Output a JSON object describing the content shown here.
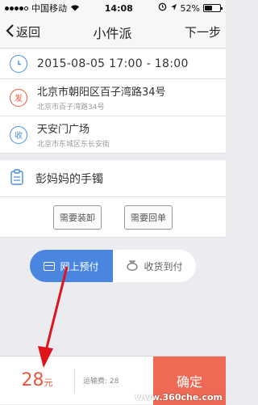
{
  "status_bar": {
    "carrier": "中国移动",
    "time": "14:08",
    "battery": "52%",
    "battery_level": 0.52
  },
  "nav": {
    "back_label": "返回",
    "title": "小件派",
    "next_label": "下一步"
  },
  "order": {
    "time": "2015-08-05  17:00 - 18:00",
    "sender": {
      "icon_label": "发",
      "address": "北京市朝阳区百子湾路34号",
      "address_sub": "北京市百子湾路34号"
    },
    "receiver": {
      "icon_label": "收",
      "address": "天安门广场",
      "address_sub": "北京市东城区东长安街"
    },
    "item_name": "彭妈妈的手镯"
  },
  "options": {
    "loading_label": "需要装卸",
    "receipt_label": "需要回单"
  },
  "payment": {
    "online_label": "网上预付",
    "cod_label": "收货到付",
    "selected": "online"
  },
  "bottom": {
    "price_value": "28",
    "price_unit": "元",
    "fee_label": "运输费: 28",
    "confirm_label": "确定"
  },
  "watermark": "www.360che.com",
  "colors": {
    "accent_blue": "#4a86e0",
    "accent_red": "#e8583f",
    "confirm_bg": "#ef6a55",
    "annotation_arrow": "#e0131b"
  }
}
